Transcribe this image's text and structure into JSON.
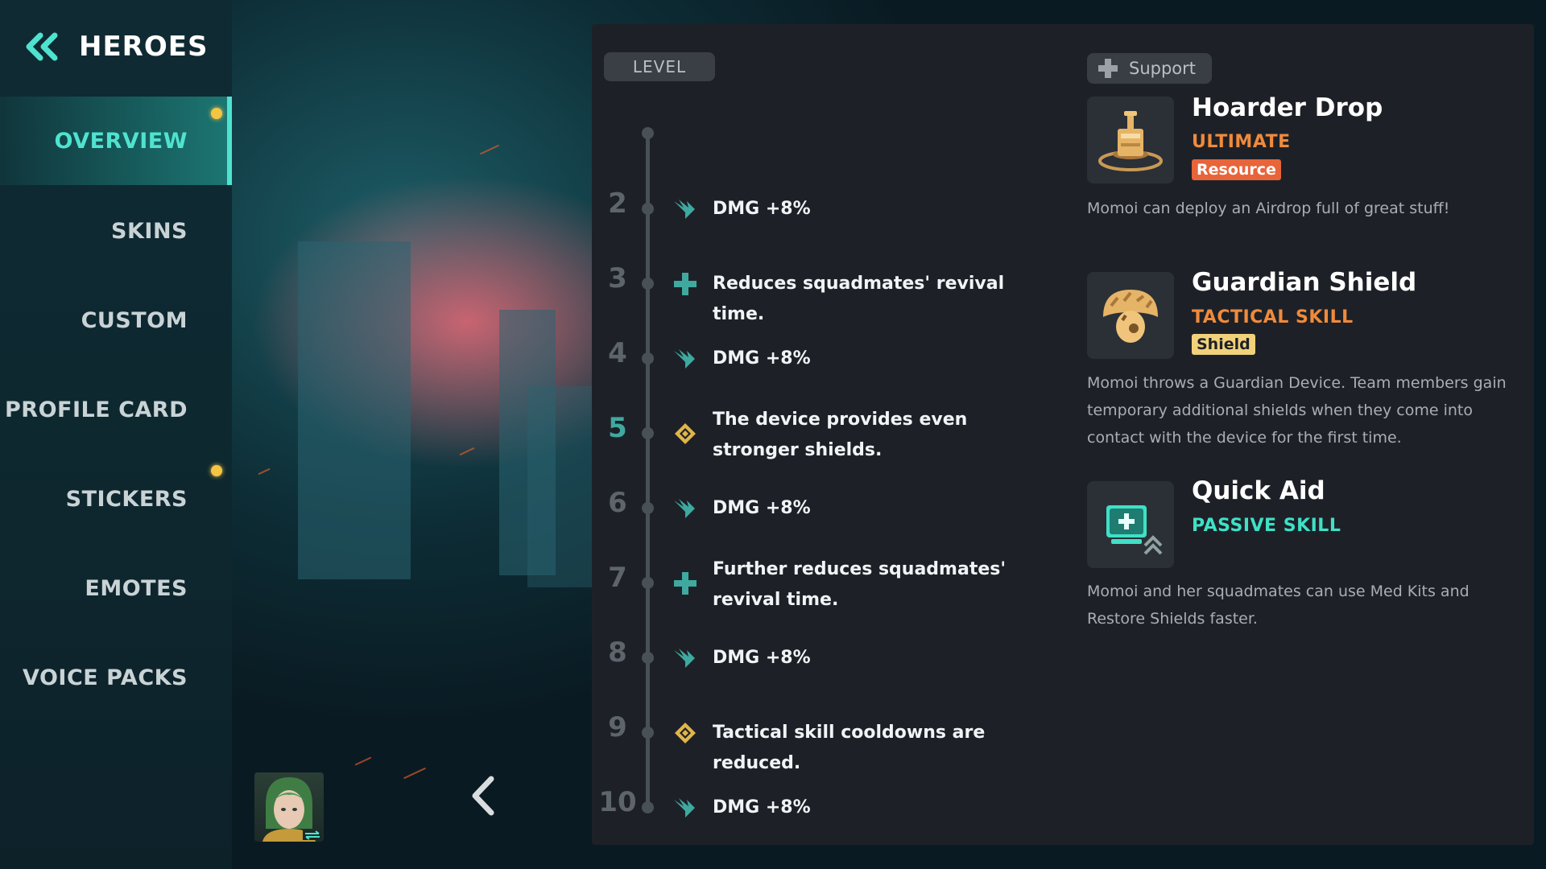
{
  "sidebar": {
    "title": "HEROES",
    "back_icon": "double-chevron-left-icon",
    "items": [
      {
        "label": "OVERVIEW",
        "active": true,
        "notification": true
      },
      {
        "label": "SKINS",
        "active": false,
        "notification": false
      },
      {
        "label": "CUSTOM",
        "active": false,
        "notification": false
      },
      {
        "label": "PROFILE CARD",
        "active": false,
        "notification": false
      },
      {
        "label": "STICKERS",
        "active": false,
        "notification": true
      },
      {
        "label": "EMOTES",
        "active": false,
        "notification": false
      },
      {
        "label": "VOICE PACKS",
        "active": false,
        "notification": false
      }
    ]
  },
  "level_panel": {
    "header": "LEVEL",
    "levels": [
      {
        "num": "2",
        "icon": "wing-icon",
        "text": "DMG +8%"
      },
      {
        "num": "3",
        "icon": "plus-icon",
        "text": "Reduces squadmates' revival time."
      },
      {
        "num": "4",
        "icon": "wing-icon",
        "text": "DMG +8%"
      },
      {
        "num": "5",
        "icon": "diamond-icon",
        "text": "The device provides even stronger shields.",
        "highlight": true
      },
      {
        "num": "6",
        "icon": "wing-icon",
        "text": "DMG +8%"
      },
      {
        "num": "7",
        "icon": "plus-icon",
        "text": "Further reduces squadmates' revival time."
      },
      {
        "num": "8",
        "icon": "wing-icon",
        "text": "DMG +8%"
      },
      {
        "num": "9",
        "icon": "diamond-icon",
        "text": "Tactical skill cooldowns are reduced."
      },
      {
        "num": "10",
        "icon": "wing-icon",
        "text": "DMG +8%"
      }
    ]
  },
  "skills": {
    "role": "Support",
    "role_icon": "plus-icon",
    "list": [
      {
        "name": "Hoarder Drop",
        "type": "ULTIMATE",
        "type_color": "#f08a3c",
        "tag": "Resource",
        "tag_bg": "#e8643a",
        "tag_color": "#ffffff",
        "icon": "airdrop-icon",
        "desc": "Momoi can deploy an Airdrop full of great stuff!"
      },
      {
        "name": "Guardian Shield",
        "type": "TACTICAL SKILL",
        "type_color": "#f08a3c",
        "tag": "Shield",
        "tag_bg": "#f1d27a",
        "tag_color": "#1d2127",
        "icon": "shield-device-icon",
        "desc": "Momoi throws a Guardian Device. Team members gain temporary additional shields when they come into contact with the device for the first time."
      },
      {
        "name": "Quick Aid",
        "type": "PASSIVE SKILL",
        "type_color": "#3fe0c6",
        "tag": "",
        "icon": "medkit-icon",
        "desc": "Momoi and her squadmates can use Med Kits and Restore Shields faster."
      }
    ]
  },
  "colors": {
    "accent_teal": "#4fe3cf",
    "notification": "#f4c542",
    "panel_bg": "#1d2127"
  }
}
